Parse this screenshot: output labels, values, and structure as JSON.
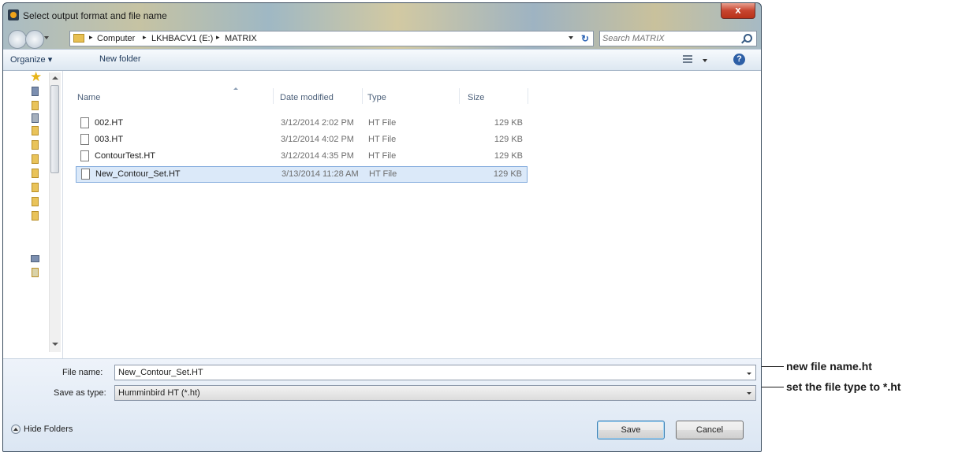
{
  "window": {
    "title": "Select output format and file name",
    "close_label": "x"
  },
  "address_bar": {
    "breadcrumbs": [
      "Computer",
      "LKHBACV1 (E:)",
      "MATRIX"
    ],
    "search_placeholder": "Search MATRIX"
  },
  "toolbar": {
    "organize_label": "Organize",
    "new_folder_label": "New folder",
    "help_label": "?"
  },
  "columns": {
    "name": "Name",
    "date": "Date modified",
    "type": "Type",
    "size": "Size"
  },
  "files": [
    {
      "name": "002.HT",
      "date": "3/12/2014 2:02 PM",
      "type": "HT File",
      "size": "129 KB"
    },
    {
      "name": "003.HT",
      "date": "3/12/2014 4:02 PM",
      "type": "HT File",
      "size": "129 KB"
    },
    {
      "name": "ContourTest.HT",
      "date": "3/12/2014 4:35 PM",
      "type": "HT File",
      "size": "129 KB"
    },
    {
      "name": "New_Contour_Set.HT",
      "date": "3/13/2014 11:28 AM",
      "type": "HT File",
      "size": "129 KB",
      "selected": true
    }
  ],
  "form": {
    "file_name_label": "File name:",
    "file_name_value": "New_Contour_Set.HT",
    "save_type_label": "Save as type:",
    "save_type_value": "Humminbird HT (*.ht)"
  },
  "buttons": {
    "hide_folders": "Hide Folders",
    "save": "Save",
    "cancel": "Cancel"
  },
  "annotations": {
    "file_name_callout": "new file name.ht",
    "file_type_callout": "set the file type to *.ht"
  }
}
